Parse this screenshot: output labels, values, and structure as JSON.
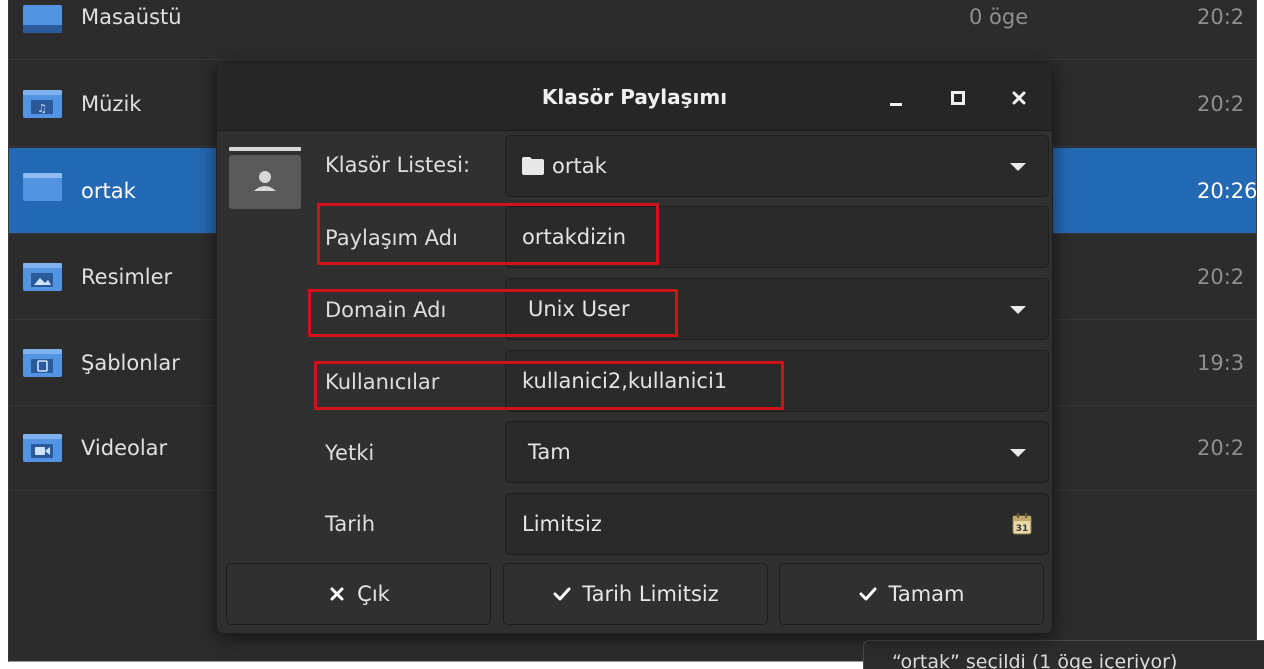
{
  "file_list": [
    {
      "name": "Masaüstü",
      "count": "0 öge",
      "time": "20:2",
      "icon": "desktop-folder-icon",
      "selected": false
    },
    {
      "name": "Müzik",
      "count": "",
      "time": "20:2",
      "icon": "music-folder-icon",
      "selected": false
    },
    {
      "name": "ortak",
      "count": "",
      "time": "20:26",
      "icon": "folder-icon",
      "selected": true
    },
    {
      "name": "Resimler",
      "count": "",
      "time": "20:2",
      "icon": "pictures-folder-icon",
      "selected": false
    },
    {
      "name": "Şablonlar",
      "count": "",
      "time": "19:3",
      "icon": "templates-folder-icon",
      "selected": false
    },
    {
      "name": "Videolar",
      "count": "",
      "time": "20:2",
      "icon": "videos-folder-icon",
      "selected": false
    }
  ],
  "status_bar": "“ortak” seçildi (1 öge içeriyor)",
  "dialog": {
    "title": "Klasör Paylaşımı",
    "share_icon": "folder-share-icon",
    "fields": {
      "folder_list": {
        "label": "Klasör Listesi:",
        "value": "ortak",
        "icon": "folder-icon"
      },
      "share_name": {
        "label": "Paylaşım Adı",
        "value": "ortakdizin"
      },
      "domain_name": {
        "label": "Domain Adı",
        "value": "Unix User"
      },
      "users": {
        "label": "Kullanıcılar",
        "value": "kullanici2,kullanici1"
      },
      "permission": {
        "label": "Yetki",
        "value": "Tam"
      },
      "date": {
        "label": "Tarih",
        "value": "Limitsiz",
        "icon": "calendar-icon"
      }
    },
    "buttons": {
      "exit": "Çık",
      "unlimited_date": "Tarih Limitsiz",
      "ok": "Tamam"
    }
  },
  "colors": {
    "background": "#2c2c2c",
    "dialog": "#303030",
    "selection": "#2469b4",
    "folder": "#5294e2",
    "highlight_box": "#d0121b"
  }
}
